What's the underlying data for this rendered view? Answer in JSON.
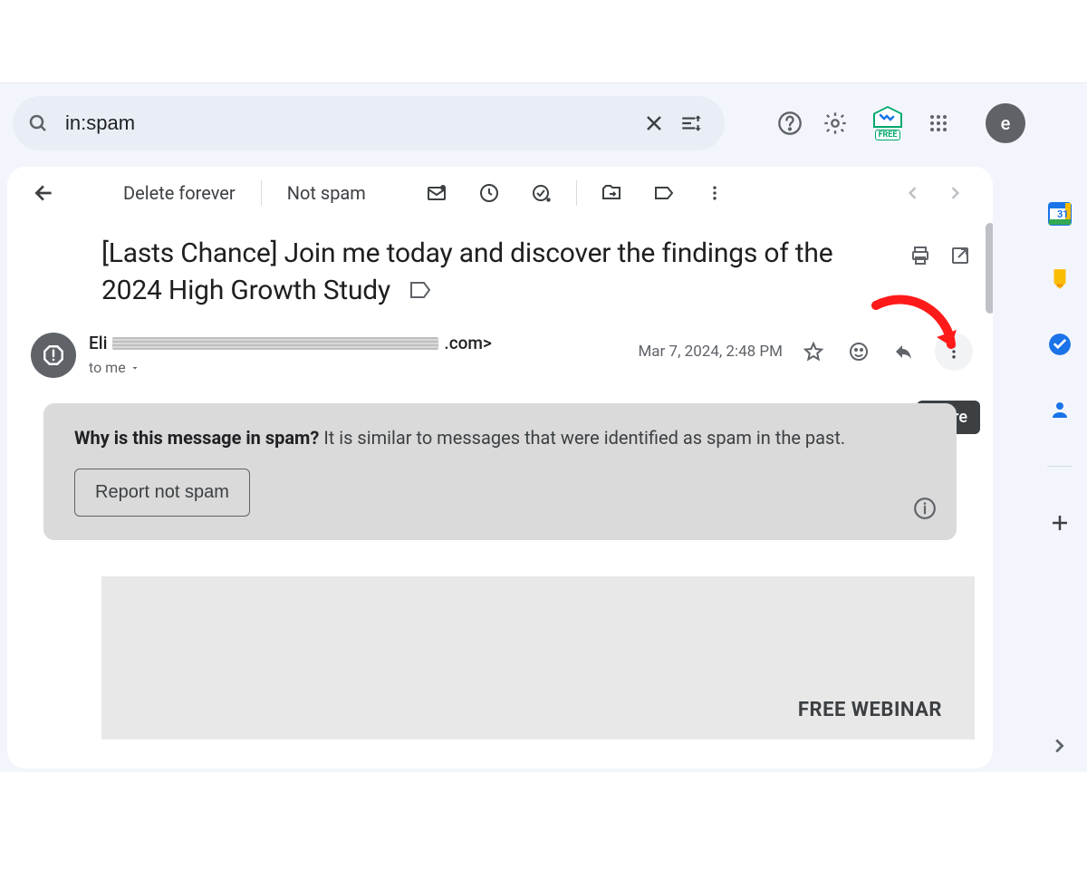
{
  "search": {
    "value": "in:spam"
  },
  "toolbar": {
    "delete_forever": "Delete forever",
    "not_spam": "Not spam"
  },
  "subject": "[Lasts Chance] Join me today and discover the findings of the 2024 High Growth Study",
  "sender": {
    "prefix": "Eli",
    "suffix": ".com>",
    "to": "to me"
  },
  "meta": {
    "date": "Mar 7, 2024, 2:48 PM"
  },
  "tooltip": {
    "more": "More"
  },
  "spam_banner": {
    "question": "Why is this message in spam?",
    "reason": "It is similar to messages that were identified as spam in the past.",
    "report_btn": "Report not spam"
  },
  "body": {
    "free_webinar": "FREE WEBINAR"
  },
  "avatar": {
    "letter": "e"
  },
  "free_badge": {
    "label": "FREE"
  },
  "calendar_day": "31"
}
